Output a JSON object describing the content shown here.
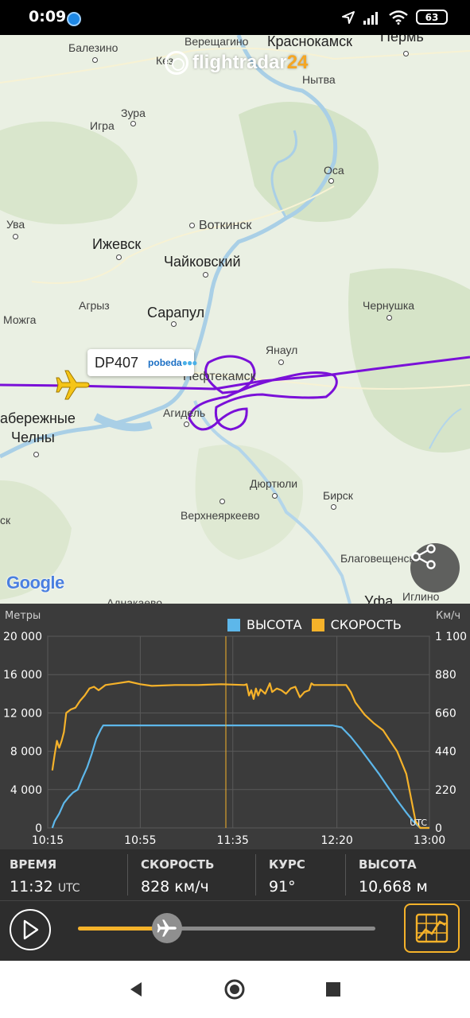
{
  "status_bar": {
    "time": "0:09",
    "battery": "63",
    "icons": [
      "app-notification-icon",
      "location-arrow-icon",
      "cell-signal-icon",
      "wifi-icon",
      "battery-icon"
    ]
  },
  "map": {
    "brand": {
      "text_main": "flightradar",
      "text_accent": "24",
      "accent_color": "#f5a623"
    },
    "flight_tag": {
      "callsign": "DP407",
      "airline_logo_text": "pobeda",
      "airline_logo_dots": "●●●"
    },
    "track_color": "#7a10d8",
    "google_logo": "Google",
    "cities": {
      "balezino": "Балезино",
      "vereshchagino": "Верещагино",
      "krasnokamsk": "Краснокамск",
      "perm": "Пермь",
      "kez": "Кез",
      "nytva": "Нытва",
      "zura": "Зура",
      "igra": "Игра",
      "osa": "Оса",
      "uva": "Ува",
      "votkinsk": "Воткинск",
      "izhevsk": "Ижевск",
      "chaikovsky": "Чайковский",
      "agryz": "Агрыз",
      "sarapul": "Сарапул",
      "chernushka": "Чернушка",
      "mozhga": "Можга",
      "yanaul": "Янаул",
      "neftekamsk": "Нефтекамск",
      "agidel": "Агидель",
      "naberezhnye_1": "абережные",
      "naberezhnye_2": "Челны",
      "dyurtyuli": "Дюртюли",
      "birsk": "Бирск",
      "verkhneyarkeevo": "Верхнеяркеево",
      "blagoveshchensk": "Благовещенск",
      "iglino": "Иглино",
      "ufa": "Уфа",
      "edge_sk": "ск",
      "bottom_partial": "Аднакаево"
    }
  },
  "chart": {
    "left_axis_title": "Метры",
    "right_axis_title": "Км/ч",
    "legend": [
      {
        "label": "ВЫСОТА",
        "color": "#5db7ea"
      },
      {
        "label": "СКОРОСТЬ",
        "color": "#f5b22a"
      }
    ],
    "utc_label": "UTC"
  },
  "chart_data": {
    "type": "line",
    "title": "",
    "xlabel": "",
    "ylabel": "Метры",
    "y2label": "Км/ч",
    "x_ticks": [
      "10:15",
      "10:55",
      "11:35",
      "12:20",
      "13:00"
    ],
    "x_tick_minutes": [
      615,
      655,
      695,
      740,
      780
    ],
    "xlim_minutes": [
      615,
      780
    ],
    "y_ticks": [
      "20 000",
      "16 000",
      "12 000",
      "8 000",
      "4 000",
      "0"
    ],
    "ylim": [
      0,
      20000
    ],
    "y2_ticks": [
      "1 100",
      "880",
      "660",
      "440",
      "220",
      "0"
    ],
    "y2lim": [
      0,
      1100
    ],
    "cursor_minutes": 692,
    "grid": true,
    "legend_position": "top-right",
    "series": [
      {
        "name": "ВЫСОТА",
        "axis": "left",
        "color": "#5db7ea",
        "points": [
          [
            617,
            0
          ],
          [
            618,
            700
          ],
          [
            620,
            1500
          ],
          [
            622,
            2600
          ],
          [
            624,
            3200
          ],
          [
            626,
            3700
          ],
          [
            628,
            4000
          ],
          [
            630,
            5200
          ],
          [
            632,
            6300
          ],
          [
            634,
            7700
          ],
          [
            636,
            9300
          ],
          [
            638,
            10300
          ],
          [
            639,
            10700
          ],
          [
            660,
            10700
          ],
          [
            680,
            10700
          ],
          [
            700,
            10700
          ],
          [
            720,
            10700
          ],
          [
            738,
            10700
          ],
          [
            742,
            10500
          ],
          [
            746,
            9500
          ],
          [
            750,
            8300
          ],
          [
            754,
            7000
          ],
          [
            758,
            5700
          ],
          [
            762,
            4300
          ],
          [
            766,
            2900
          ],
          [
            770,
            1600
          ],
          [
            773,
            700
          ],
          [
            776,
            0
          ],
          [
            780,
            0
          ]
        ]
      },
      {
        "name": "СКОРОСТЬ",
        "axis": "right",
        "color": "#f5b22a",
        "points": [
          [
            617,
            330
          ],
          [
            618,
            420
          ],
          [
            619,
            500
          ],
          [
            620,
            460
          ],
          [
            621,
            500
          ],
          [
            622,
            550
          ],
          [
            623,
            660
          ],
          [
            625,
            680
          ],
          [
            627,
            690
          ],
          [
            629,
            730
          ],
          [
            631,
            760
          ],
          [
            633,
            800
          ],
          [
            635,
            810
          ],
          [
            637,
            790
          ],
          [
            640,
            820
          ],
          [
            645,
            830
          ],
          [
            650,
            840
          ],
          [
            655,
            825
          ],
          [
            660,
            815
          ],
          [
            670,
            820
          ],
          [
            680,
            820
          ],
          [
            690,
            825
          ],
          [
            700,
            820
          ],
          [
            701,
            825
          ],
          [
            702,
            760
          ],
          [
            703,
            790
          ],
          [
            704,
            740
          ],
          [
            705,
            800
          ],
          [
            706,
            760
          ],
          [
            707,
            795
          ],
          [
            709,
            770
          ],
          [
            711,
            830
          ],
          [
            712,
            780
          ],
          [
            714,
            800
          ],
          [
            716,
            790
          ],
          [
            718,
            770
          ],
          [
            720,
            800
          ],
          [
            722,
            810
          ],
          [
            724,
            750
          ],
          [
            726,
            780
          ],
          [
            728,
            790
          ],
          [
            729,
            830
          ],
          [
            730,
            820
          ],
          [
            740,
            820
          ],
          [
            744,
            820
          ],
          [
            746,
            780
          ],
          [
            748,
            720
          ],
          [
            752,
            650
          ],
          [
            756,
            600
          ],
          [
            760,
            560
          ],
          [
            763,
            500
          ],
          [
            766,
            440
          ],
          [
            770,
            310
          ],
          [
            774,
            40
          ],
          [
            776,
            0
          ],
          [
            780,
            0
          ]
        ]
      }
    ]
  },
  "flight_info": {
    "time_label": "ВРЕМЯ",
    "time_value": "11:32",
    "time_unit": "UTC",
    "speed_label": "СКОРОСТЬ",
    "speed_value": "828 км/ч",
    "heading_label": "КУРС",
    "heading_value": "91°",
    "altitude_label": "ВЫСОТА",
    "altitude_value": "10,668 м"
  },
  "playback": {
    "progress": 0.3,
    "fill_color": "#f5b22a"
  },
  "nav": {
    "icons": [
      "back-icon",
      "home-icon",
      "recents-icon"
    ]
  }
}
